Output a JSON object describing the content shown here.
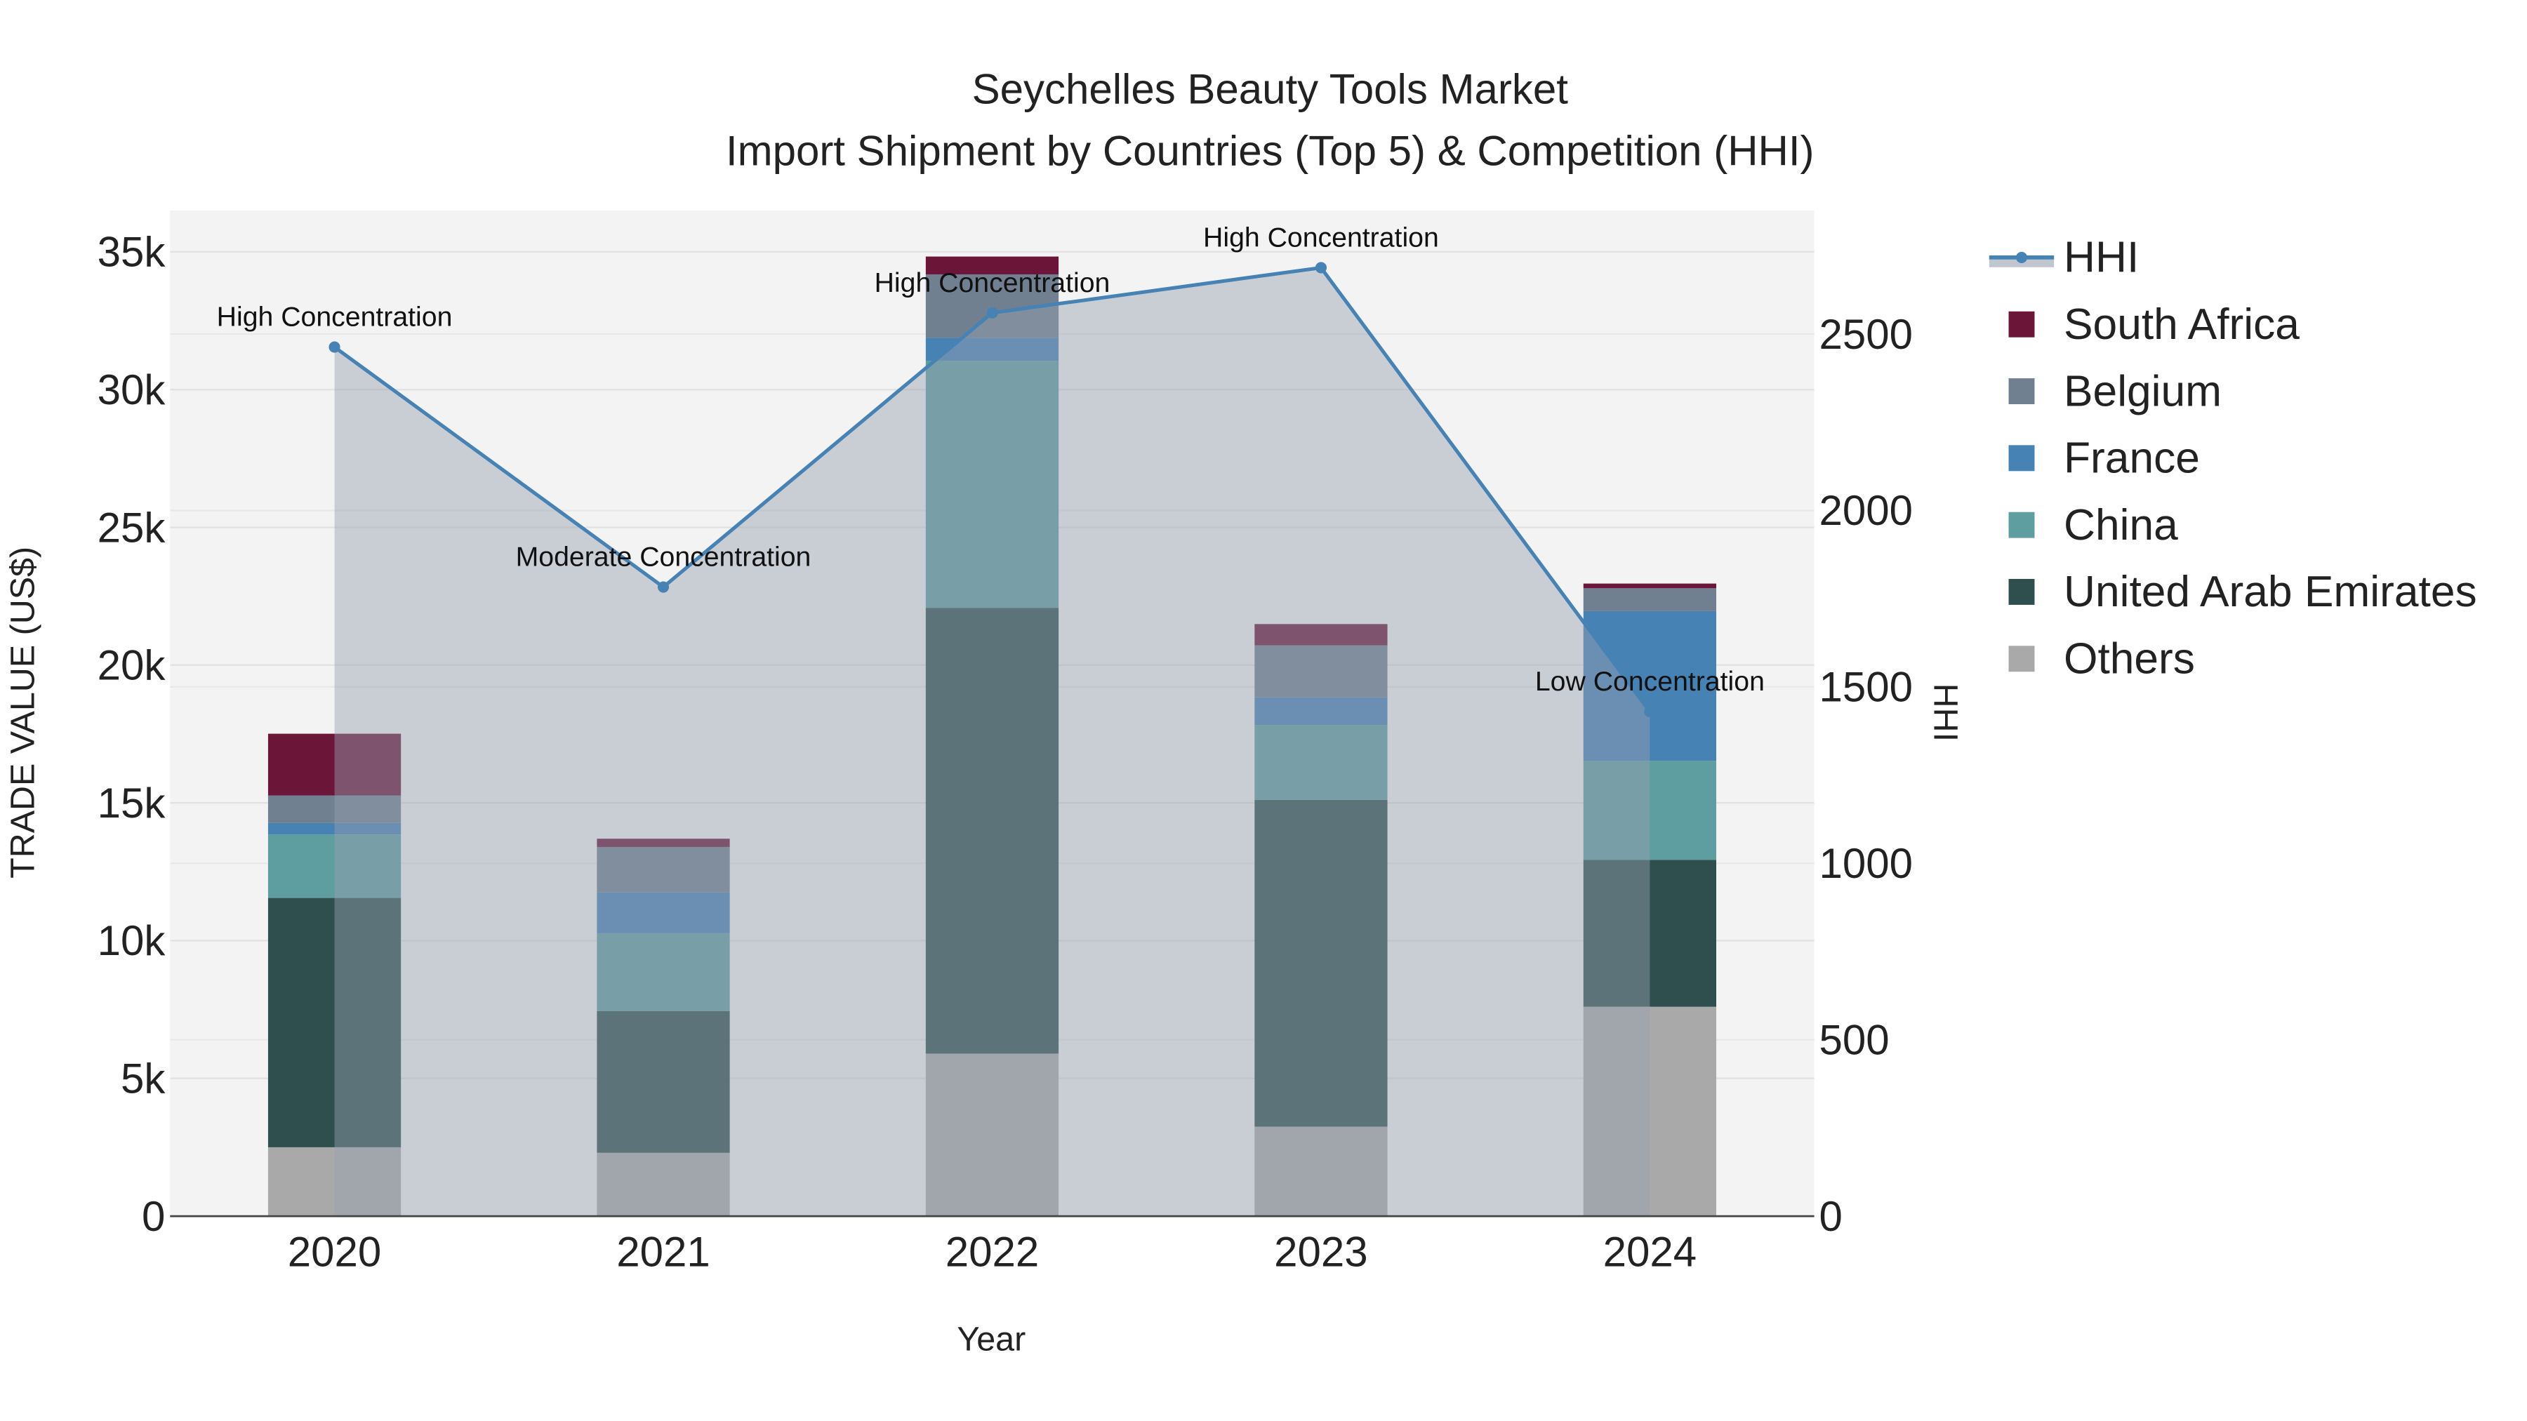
{
  "chart_data": {
    "type": "bar",
    "title_line1": "Seychelles Beauty Tools Market",
    "title_line2": "Import Shipment by Countries (Top 5) & Competition (HHI)",
    "xlabel": "Year",
    "ylabel": "TRADE VALUE (US$)",
    "y2label": "HHI",
    "categories": [
      "2020",
      "2021",
      "2022",
      "2023",
      "2024"
    ],
    "ylim": [
      0,
      36500
    ],
    "y_ticks": [
      0,
      5000,
      10000,
      15000,
      20000,
      25000,
      30000,
      35000
    ],
    "y_tick_labels": [
      "0",
      "5k",
      "10k",
      "15k",
      "20k",
      "25k",
      "30k",
      "35k"
    ],
    "y2lim": [
      0,
      2850
    ],
    "y2_ticks": [
      0,
      500,
      1000,
      1500,
      2000,
      2500
    ],
    "y2_tick_labels": [
      "0",
      "500",
      "1000",
      "1500",
      "2000",
      "2500"
    ],
    "stacked": true,
    "series": [
      {
        "name": "Others",
        "color": "#a9a9a9",
        "values": [
          2500,
          2300,
          5900,
          3250,
          7600
        ]
      },
      {
        "name": "United Arab Emirates",
        "color": "#2f4f4f",
        "values": [
          9050,
          5140,
          16180,
          11860,
          5330
        ]
      },
      {
        "name": "China",
        "color": "#5f9ea0",
        "values": [
          2300,
          2830,
          8970,
          2720,
          3600
        ]
      },
      {
        "name": "France",
        "color": "#4682b4",
        "values": [
          420,
          1480,
          830,
          1000,
          5430
        ]
      },
      {
        "name": "Belgium",
        "color": "#708090",
        "values": [
          1000,
          1650,
          2300,
          1890,
          830
        ]
      },
      {
        "name": "South Africa",
        "color": "#6b1538",
        "values": [
          2240,
          300,
          650,
          770,
          170
        ]
      }
    ],
    "hhi": {
      "name": "HHI",
      "color": "#4682b4",
      "values": [
        2463,
        1783,
        2560,
        2688,
        1430
      ],
      "annotations": [
        "High Concentration",
        "Moderate Concentration",
        "High Concentration",
        "High Concentration",
        "Low Concentration"
      ]
    },
    "legend_order": [
      "HHI",
      "South Africa",
      "Belgium",
      "France",
      "China",
      "United Arab Emirates",
      "Others"
    ],
    "legend_position": "right",
    "grid": true
  }
}
